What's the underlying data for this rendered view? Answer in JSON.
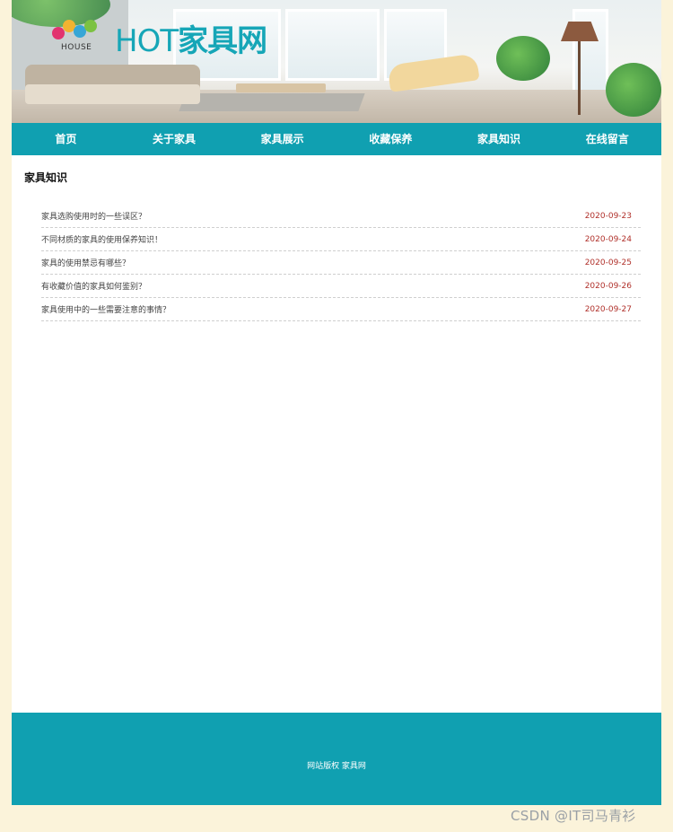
{
  "logo": {
    "house_text": "HOUSE",
    "brand_en": "HOT",
    "brand_cn": "家具网"
  },
  "nav": {
    "items": [
      "首页",
      "关于家具",
      "家具展示",
      "收藏保养",
      "家具知识",
      "在线留言"
    ]
  },
  "main": {
    "section_title": "家具知识",
    "articles": [
      {
        "title": "家具选购使用时的一些误区？",
        "date": "2020-09-23"
      },
      {
        "title": "不同材质的家具的使用保养知识！",
        "date": "2020-09-24"
      },
      {
        "title": "家具的使用禁忌有哪些？",
        "date": "2020-09-25"
      },
      {
        "title": "有收藏价值的家具如何鉴别？",
        "date": "2020-09-26"
      },
      {
        "title": "家具使用中的一些需要注意的事情？",
        "date": "2020-09-27"
      }
    ]
  },
  "footer": {
    "copyright": "网站版权 家具网"
  },
  "watermark": "CSDN @IT司马青衫",
  "colors": {
    "accent": "#10a0b1",
    "date": "#b0302a",
    "background": "#fbf3da"
  }
}
